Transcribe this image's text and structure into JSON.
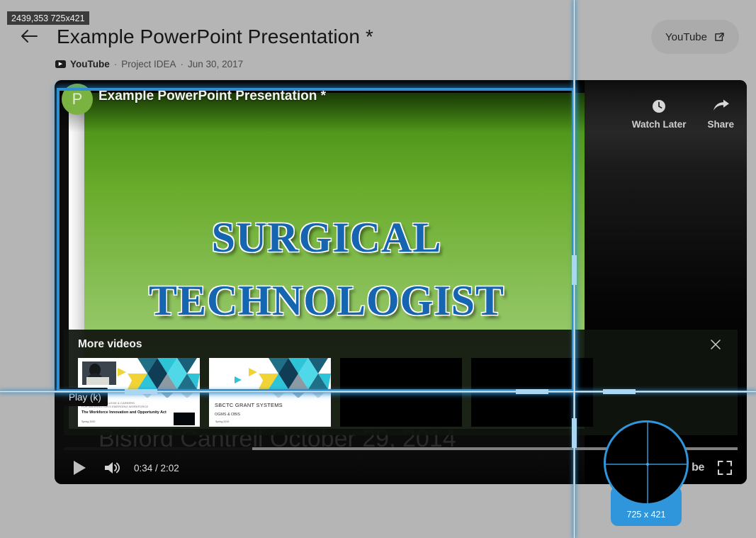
{
  "header": {
    "back_icon": "back-arrow-icon",
    "title": "Example PowerPoint Presentation *",
    "source": "YouTube",
    "sep1": "·",
    "channel": "Project IDEA",
    "sep2": "·",
    "date": "Jun 30, 2017",
    "open_chip_label": "YouTube",
    "open_chip_icon": "external-link-icon"
  },
  "overlay": {
    "size_badge": "2439,353 725x421",
    "magnifier_label": "725 x 421",
    "selection_color": "#2f8fd0",
    "crosshair_color": "#6fb9e8"
  },
  "player": {
    "slide_title": "Example PowerPoint Presentation *",
    "slide_avatar": "P",
    "slide_heading_line1": "SURGICAL",
    "slide_heading_line2": "TECHNOLOGIST",
    "presenter_line": "Bisford Cantrell  October 29, 2014",
    "top_actions": [
      {
        "label": "Watch Later",
        "icon": "clock-icon"
      },
      {
        "label": "Share",
        "icon": "share-arrow-icon"
      }
    ],
    "controls": {
      "play_icon": "play-icon",
      "volume_icon": "volume-icon",
      "time": "0:34 / 2:02",
      "wordmark": "be",
      "fullscreen_icon": "fullscreen-icon",
      "progress_percent": 28,
      "tooltip": "Play (k)"
    }
  },
  "more_videos": {
    "title": "More videos",
    "close_icon": "close-icon",
    "thumbnails": [
      {
        "kicker_line1": "PATHWAYS TO COLLEGE & CAREERS",
        "kicker_line2": "FOR WASHINGTON'S EMERGING WORKFORCE",
        "title": "The Workforce Innovation and Opportunity Act",
        "date": "Spring 2020",
        "kind": "deck-photo"
      },
      {
        "title": "SBCTC GRANT SYSTEMS",
        "subtitle": "OGMS & OBIS",
        "date": "Spring 2019",
        "kind": "deck-plain"
      },
      {
        "kind": "placeholder"
      },
      {
        "kind": "placeholder"
      }
    ]
  }
}
